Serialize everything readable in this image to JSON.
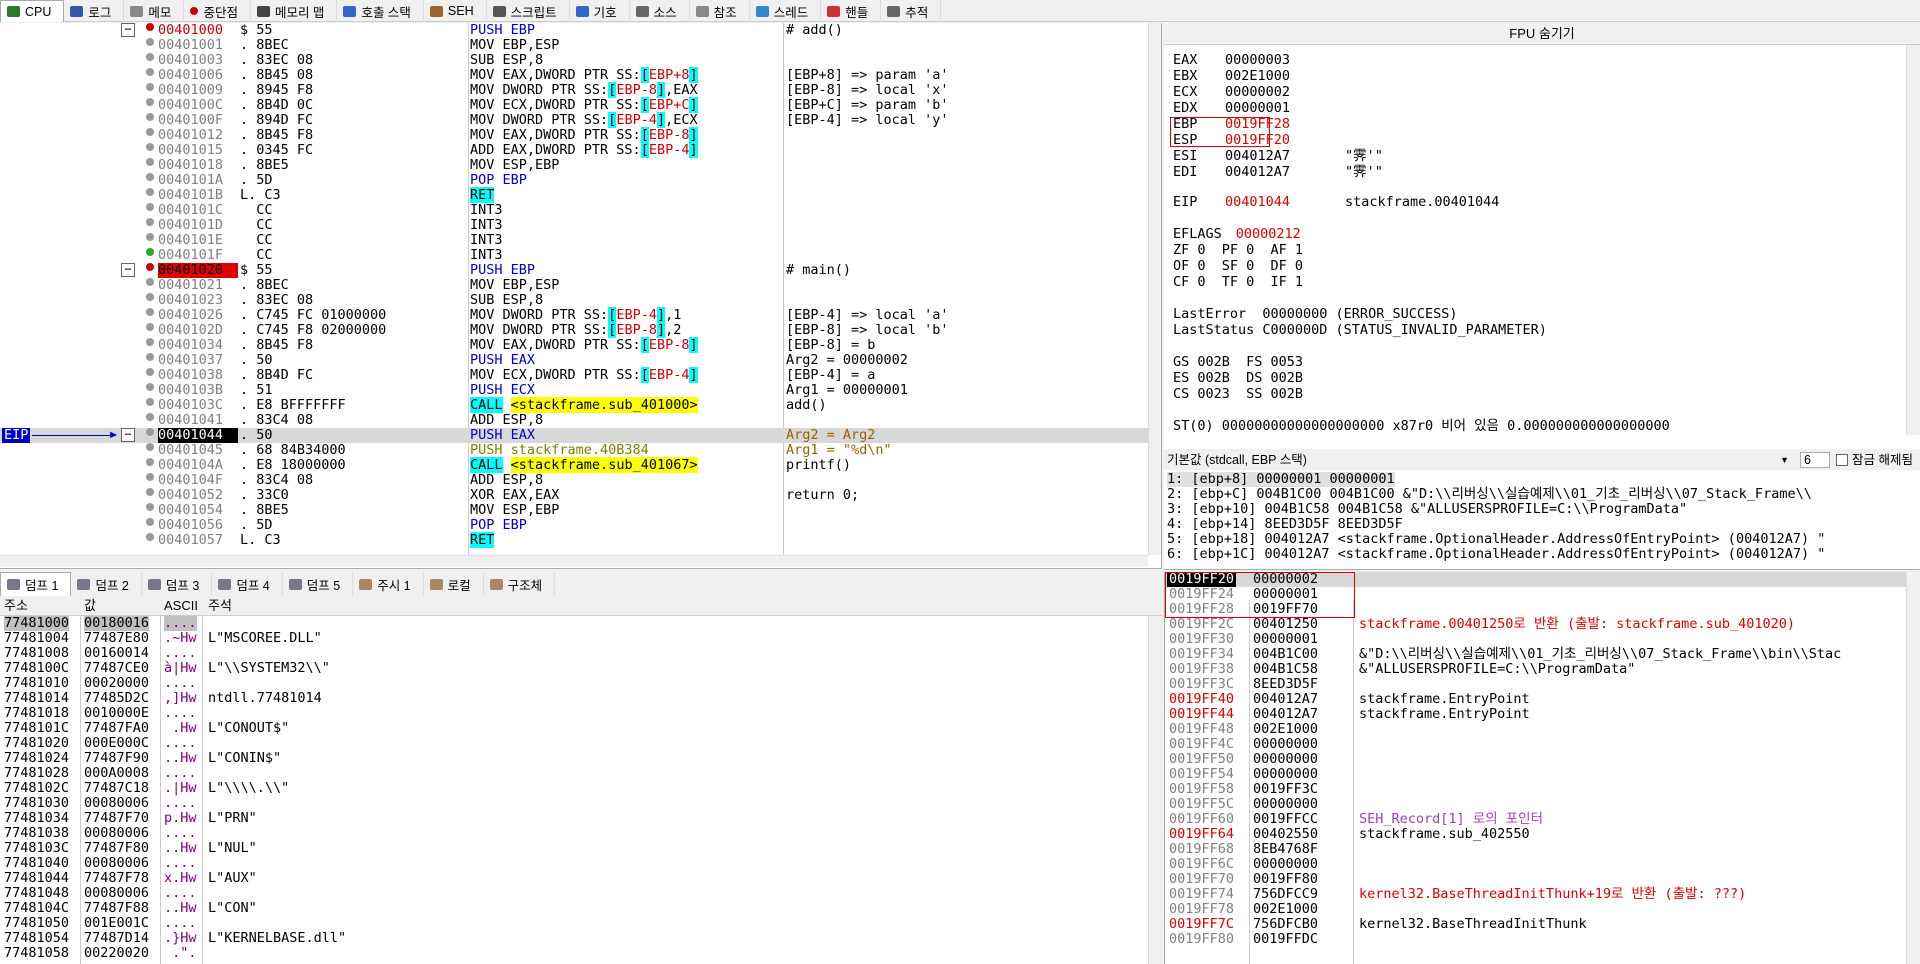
{
  "tabs": [
    "CPU",
    "로그",
    "메모",
    "중단점",
    "메모리 맵",
    "호출 스택",
    "SEH",
    "스크립트",
    "기호",
    "소스",
    "참조",
    "스레드",
    "핸들",
    "추적"
  ],
  "eip_label": "EIP",
  "disasm": [
    {
      "addr": "00401000",
      "bytes": "$ 55",
      "ins": "PUSH EBP",
      "cmt": "# add()",
      "addr_style": "red-bg-white"
    },
    {
      "addr": "00401001",
      "bytes": ". 8BEC",
      "ins": "MOV EBP,ESP",
      "cmt": ""
    },
    {
      "addr": "00401003",
      "bytes": ". 83EC 08",
      "ins": "SUB ESP,8",
      "cmt": ""
    },
    {
      "addr": "00401006",
      "bytes": ". 8B45 08",
      "ins": "MOV EAX,DWORD PTR SS:[EBP+8]",
      "cmt": "[EBP+8] => param 'a'"
    },
    {
      "addr": "00401009",
      "bytes": ". 8945 F8",
      "ins": "MOV DWORD PTR SS:[EBP-8],EAX",
      "cmt": "[EBP-8] => local 'x'"
    },
    {
      "addr": "0040100C",
      "bytes": ". 8B4D 0C",
      "ins": "MOV ECX,DWORD PTR SS:[EBP+C]",
      "cmt": "[EBP+C] => param 'b'"
    },
    {
      "addr": "0040100F",
      "bytes": ". 894D FC",
      "ins": "MOV DWORD PTR SS:[EBP-4],ECX",
      "cmt": "[EBP-4] => local 'y'"
    },
    {
      "addr": "00401012",
      "bytes": ". 8B45 F8",
      "ins": "MOV EAX,DWORD PTR SS:[EBP-8]",
      "cmt": ""
    },
    {
      "addr": "00401015",
      "bytes": ". 0345 FC",
      "ins": "ADD EAX,DWORD PTR SS:[EBP-4]",
      "cmt": ""
    },
    {
      "addr": "00401018",
      "bytes": ". 8BE5",
      "ins": "MOV ESP,EBP",
      "cmt": ""
    },
    {
      "addr": "0040101A",
      "bytes": ". 5D",
      "ins": "POP EBP",
      "cmt": ""
    },
    {
      "addr": "0040101B",
      "bytes": "L. C3",
      "ins": "RET",
      "cmt": "",
      "ins_style": "cyan"
    },
    {
      "addr": "0040101C",
      "bytes": "  CC",
      "ins": "INT3",
      "cmt": ""
    },
    {
      "addr": "0040101D",
      "bytes": "  CC",
      "ins": "INT3",
      "cmt": ""
    },
    {
      "addr": "0040101E",
      "bytes": "  CC",
      "ins": "INT3",
      "cmt": ""
    },
    {
      "addr": "0040101F",
      "bytes": "  CC",
      "ins": "INT3",
      "cmt": ""
    },
    {
      "addr": "00401020",
      "bytes": "$ 55",
      "ins": "PUSH EBP",
      "cmt": "# main()",
      "addr_style": "red-bg-black"
    },
    {
      "addr": "00401021",
      "bytes": ". 8BEC",
      "ins": "MOV EBP,ESP",
      "cmt": ""
    },
    {
      "addr": "00401023",
      "bytes": ". 83EC 08",
      "ins": "SUB ESP,8",
      "cmt": ""
    },
    {
      "addr": "00401026",
      "bytes": ". C745 FC 01000000",
      "ins": "MOV DWORD PTR SS:[EBP-4],1",
      "cmt": "[EBP-4] => local 'a'"
    },
    {
      "addr": "0040102D",
      "bytes": ". C745 F8 02000000",
      "ins": "MOV DWORD PTR SS:[EBP-8],2",
      "cmt": "[EBP-8] => local 'b'"
    },
    {
      "addr": "00401034",
      "bytes": ". 8B45 F8",
      "ins": "MOV EAX,DWORD PTR SS:[EBP-8]",
      "cmt": "[EBP-8] = b"
    },
    {
      "addr": "00401037",
      "bytes": ". 50",
      "ins": "PUSH EAX",
      "cmt": "Arg2 = 00000002"
    },
    {
      "addr": "00401038",
      "bytes": ". 8B4D FC",
      "ins": "MOV ECX,DWORD PTR SS:[EBP-4]",
      "cmt": "[EBP-4] = a"
    },
    {
      "addr": "0040103B",
      "bytes": ". 51",
      "ins": "PUSH ECX",
      "cmt": "Arg1 = 00000001"
    },
    {
      "addr": "0040103C",
      "bytes": ". E8 BFFFFFFF",
      "ins": "CALL <stackframe.sub_401000>",
      "cmt": "add()",
      "ins_style": "call"
    },
    {
      "addr": "00401041",
      "bytes": ". 83C4 08",
      "ins": "ADD ESP,8",
      "cmt": ""
    },
    {
      "addr": "00401044",
      "bytes": ". 50",
      "ins": "PUSH EAX",
      "cmt": "Arg2 = Arg2",
      "addr_style": "eip"
    },
    {
      "addr": "00401045",
      "bytes": ". 68 84B34000",
      "ins": "PUSH stackframe.40B384",
      "cmt": "Arg1 = \"%d\\n\""
    },
    {
      "addr": "0040104A",
      "bytes": ". E8 18000000",
      "ins": "CALL <stackframe.sub_401067>",
      "cmt": "printf()",
      "ins_style": "call"
    },
    {
      "addr": "0040104F",
      "bytes": ". 83C4 08",
      "ins": "ADD ESP,8",
      "cmt": ""
    },
    {
      "addr": "00401052",
      "bytes": ". 33C0",
      "ins": "XOR EAX,EAX",
      "cmt": "return 0;"
    },
    {
      "addr": "00401054",
      "bytes": ". 8BE5",
      "ins": "MOV ESP,EBP",
      "cmt": ""
    },
    {
      "addr": "00401056",
      "bytes": ". 5D",
      "ins": "POP EBP",
      "cmt": ""
    },
    {
      "addr": "00401057",
      "bytes": "L. C3",
      "ins": "RET",
      "cmt": "",
      "ins_style": "cyan"
    }
  ],
  "fpu_title": "FPU 숨기기",
  "registers": [
    {
      "name": "EAX",
      "value": "00000003",
      "extra": ""
    },
    {
      "name": "EBX",
      "value": "002E1000",
      "extra": ""
    },
    {
      "name": "ECX",
      "value": "00000002",
      "extra": ""
    },
    {
      "name": "EDX",
      "value": "00000001",
      "extra": ""
    },
    {
      "name": "EBP",
      "value": "0019FF28",
      "extra": "",
      "changed": true
    },
    {
      "name": "ESP",
      "value": "0019FF20",
      "extra": "",
      "changed": true
    },
    {
      "name": "ESI",
      "value": "004012A7",
      "extra": "\"霁'\""
    },
    {
      "name": "EDI",
      "value": "004012A7",
      "extra": "\"霁'\""
    }
  ],
  "eip_reg": {
    "name": "EIP",
    "value": "00401044",
    "extra": "stackframe.00401044"
  },
  "eflags": {
    "name": "EFLAGS",
    "value": "00000212"
  },
  "flags_rows": [
    "ZF 0  PF 0  AF 1",
    "OF 0  SF 0  DF 0",
    "CF 0  TF 0  IF 1"
  ],
  "last_error": "LastError  00000000 (ERROR_SUCCESS)",
  "last_status": "LastStatus C000000D (STATUS_INVALID_PARAMETER)",
  "seg_rows": [
    "GS 002B  FS 0053",
    "ES 002B  DS 002B",
    "CS 0023  SS 002B"
  ],
  "fpu_row": "ST(0) 00000000000000000000 x87r0 비어 있음 0.000000000000000000",
  "callconv": {
    "label": "기본값 (stdcall, EBP 스택)",
    "count": "6",
    "lock": "잠금 해제됨"
  },
  "args": [
    "1: [ebp+8] 00000001 00000001",
    "2: [ebp+C] 004B1C00 004B1C00 &\"D:\\\\리버싱\\\\실습예제\\\\01_기초_리버싱\\\\07_Stack_Frame\\\\",
    "3: [ebp+10] 004B1C58 004B1C58 &\"ALLUSERSPROFILE=C:\\\\ProgramData\"",
    "4: [ebp+14] 8EED3D5F 8EED3D5F",
    "5: [ebp+18] 004012A7 <stackframe.OptionalHeader.AddressOfEntryPoint> (004012A7) \"",
    "6: [ebp+1C] 004012A7 <stackframe.OptionalHeader.AddressOfEntryPoint> (004012A7) \""
  ],
  "dump_tabs": [
    "덤프 1",
    "덤프 2",
    "덤프 3",
    "덤프 4",
    "덤프 5",
    "주시 1",
    "로컬",
    "구조체"
  ],
  "dump_headers": [
    "주소",
    "값",
    "ASCII",
    "주석"
  ],
  "dump_rows": [
    [
      "77481000",
      "00180016",
      "....",
      ""
    ],
    [
      "77481004",
      "77487E80",
      ".~Hw",
      "L\"MSCOREE.DLL\""
    ],
    [
      "77481008",
      "00160014",
      "....",
      ""
    ],
    [
      "7748100C",
      "77487CE0",
      "à|Hw",
      "L\"\\\\SYSTEM32\\\\\""
    ],
    [
      "77481010",
      "00020000",
      "....",
      ""
    ],
    [
      "77481014",
      "77485D2C",
      ",]Hw",
      "ntdll.77481014"
    ],
    [
      "77481018",
      "0010000E",
      "....",
      ""
    ],
    [
      "7748101C",
      "77487FA0",
      " .Hw",
      "L\"CONOUT$\""
    ],
    [
      "77481020",
      "000E000C",
      "....",
      ""
    ],
    [
      "77481024",
      "77487F90",
      "..Hw",
      "L\"CONIN$\""
    ],
    [
      "77481028",
      "000A0008",
      "....",
      ""
    ],
    [
      "7748102C",
      "77487C18",
      ".|Hw",
      "L\"\\\\\\\\.\\\\\""
    ],
    [
      "77481030",
      "00080006",
      "....",
      ""
    ],
    [
      "77481034",
      "77487F70",
      "p.Hw",
      "L\"PRN\""
    ],
    [
      "77481038",
      "00080006",
      "....",
      ""
    ],
    [
      "7748103C",
      "77487F80",
      "..Hw",
      "L\"NUL\""
    ],
    [
      "77481040",
      "00080006",
      "....",
      ""
    ],
    [
      "77481044",
      "77487F78",
      "x.Hw",
      "L\"AUX\""
    ],
    [
      "77481048",
      "00080006",
      "....",
      ""
    ],
    [
      "7748104C",
      "77487F88",
      "..Hw",
      "L\"CON\""
    ],
    [
      "77481050",
      "001E001C",
      "....",
      ""
    ],
    [
      "77481054",
      "77487D14",
      ".}Hw",
      "L\"KERNELBASE.dll\""
    ],
    [
      "77481058",
      "00220020",
      " .\".",
      ""
    ]
  ],
  "stack_rows": [
    {
      "addr": "0019FF20",
      "value": "00000002",
      "cmt": "",
      "top": true
    },
    {
      "addr": "0019FF24",
      "value": "00000001",
      "cmt": ""
    },
    {
      "addr": "0019FF28",
      "value": "0019FF70",
      "cmt": ""
    },
    {
      "addr": "0019FF2C",
      "value": "00401250",
      "cmt": "stackframe.00401250로 반환 (출발: stackframe.sub_401020)",
      "cmt_class": "red"
    },
    {
      "addr": "0019FF30",
      "value": "00000001",
      "cmt": ""
    },
    {
      "addr": "0019FF34",
      "value": "004B1C00",
      "cmt": "&\"D:\\\\리버싱\\\\실습예제\\\\01_기초_리버싱\\\\07_Stack_Frame\\\\bin\\\\Stac"
    },
    {
      "addr": "0019FF38",
      "value": "004B1C58",
      "cmt": "&\"ALLUSERSPROFILE=C:\\\\ProgramData\""
    },
    {
      "addr": "0019FF3C",
      "value": "8EED3D5F",
      "cmt": ""
    },
    {
      "addr": "0019FF40",
      "value": "004012A7",
      "cmt": "stackframe.EntryPoint",
      "addr_class": "red"
    },
    {
      "addr": "0019FF44",
      "value": "004012A7",
      "cmt": "stackframe.EntryPoint",
      "addr_class": "red"
    },
    {
      "addr": "0019FF48",
      "value": "002E1000",
      "cmt": ""
    },
    {
      "addr": "0019FF4C",
      "value": "00000000",
      "cmt": ""
    },
    {
      "addr": "0019FF50",
      "value": "00000000",
      "cmt": ""
    },
    {
      "addr": "0019FF54",
      "value": "00000000",
      "cmt": ""
    },
    {
      "addr": "0019FF58",
      "value": "0019FF3C",
      "cmt": ""
    },
    {
      "addr": "0019FF5C",
      "value": "00000000",
      "cmt": ""
    },
    {
      "addr": "0019FF60",
      "value": "0019FFCC",
      "cmt": "SEH_Record[1] 로의 포인터",
      "cmt_class": "purple"
    },
    {
      "addr": "0019FF64",
      "value": "00402550",
      "cmt": "stackframe.sub_402550",
      "addr_class": "red"
    },
    {
      "addr": "0019FF68",
      "value": "8EB4768F",
      "cmt": ""
    },
    {
      "addr": "0019FF6C",
      "value": "00000000",
      "cmt": ""
    },
    {
      "addr": "0019FF70",
      "value": "0019FF80",
      "cmt": ""
    },
    {
      "addr": "0019FF74",
      "value": "756DFCC9",
      "cmt": "kernel32.BaseThreadInitThunk+19로 반환 (출발: ???)",
      "cmt_class": "red"
    },
    {
      "addr": "0019FF78",
      "value": "002E1000",
      "cmt": ""
    },
    {
      "addr": "0019FF7C",
      "value": "756DFCB0",
      "cmt": "kernel32.BaseThreadInitThunk",
      "addr_class": "red"
    },
    {
      "addr": "0019FF80",
      "value": "0019FFDC",
      "cmt": ""
    }
  ]
}
